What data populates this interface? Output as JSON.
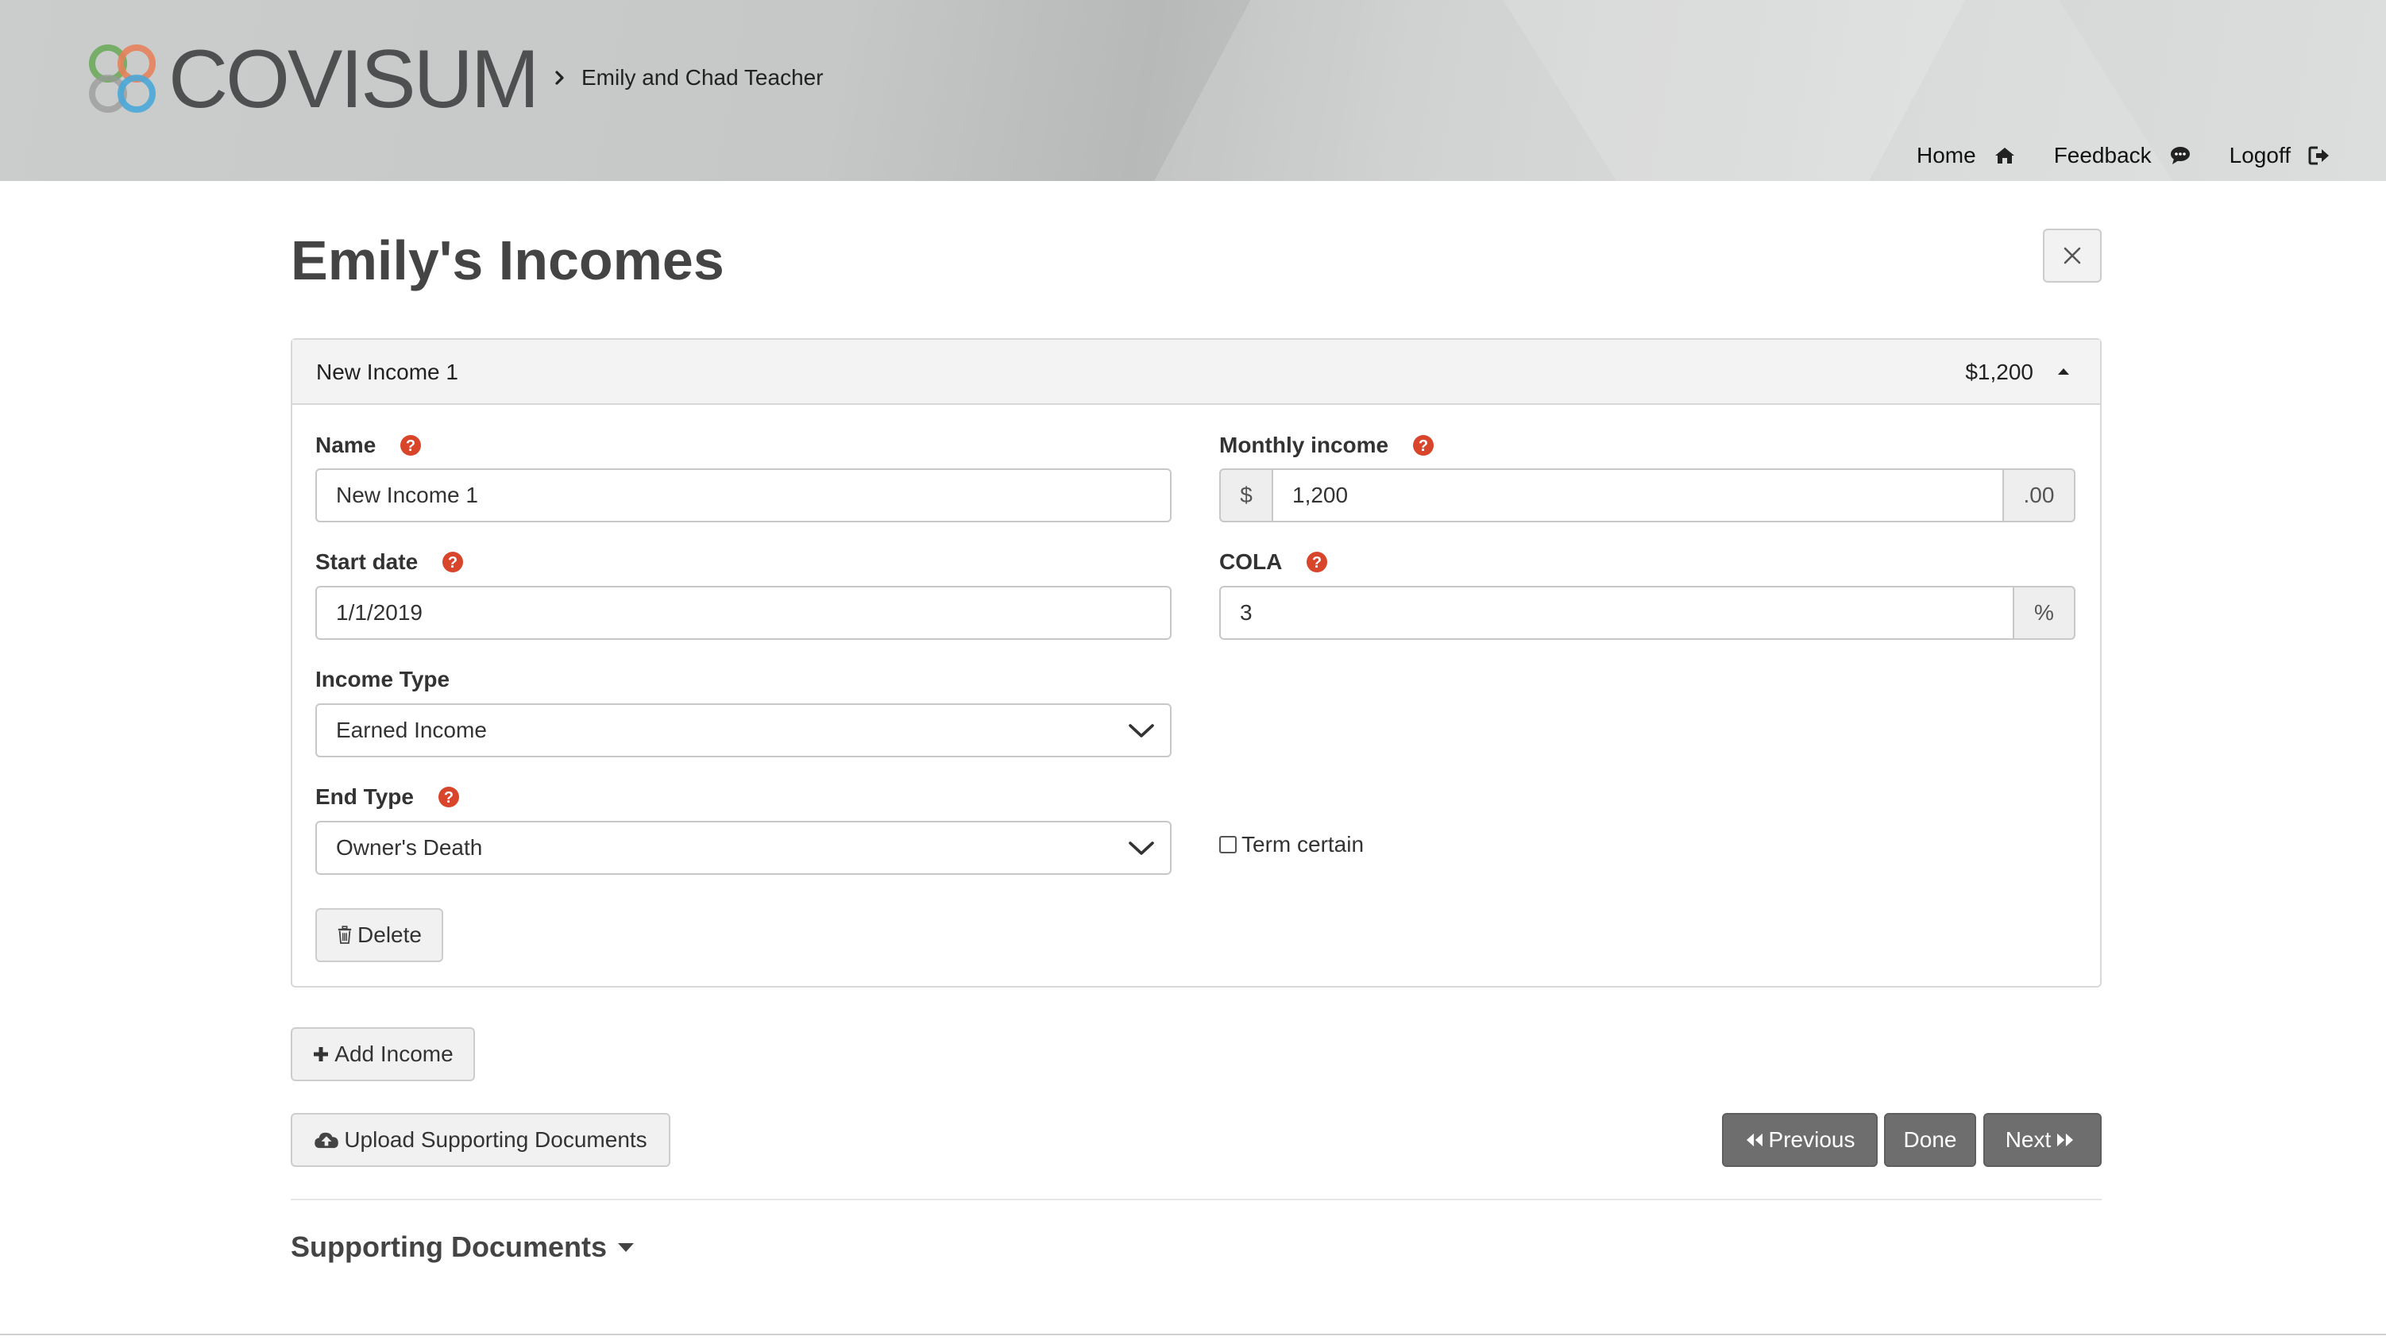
{
  "header": {
    "brand": "COVISUM",
    "breadcrumb": "Emily and Chad Teacher",
    "nav": [
      {
        "label": "Home",
        "icon": "home-icon"
      },
      {
        "label": "Feedback",
        "icon": "comment-icon"
      },
      {
        "label": "Logoff",
        "icon": "sign-out-icon"
      }
    ]
  },
  "page": {
    "title": "Emily's Incomes",
    "close_icon": "close-icon"
  },
  "income": {
    "panel_name": "New Income 1",
    "panel_amount": "$1,200",
    "name_label": "Name",
    "name_value": "New Income 1",
    "monthly_label": "Monthly income",
    "monthly_prefix": "$",
    "monthly_value": "1,200",
    "monthly_suffix": ".00",
    "start_label": "Start date",
    "start_value": "1/1/2019",
    "cola_label": "COLA",
    "cola_value": "3",
    "cola_suffix": "%",
    "type_label": "Income Type",
    "type_value": "Earned Income",
    "end_label": "End Type",
    "end_value": "Owner's Death",
    "term_label": "Term certain",
    "term_checked": false,
    "delete_label": "Delete"
  },
  "actions": {
    "add_income": "Add Income",
    "upload": "Upload Supporting Documents",
    "previous": "Previous",
    "done": "Done",
    "next": "Next"
  },
  "supporting": {
    "title": "Supporting Documents"
  },
  "colors": {
    "help_red": "#d9452b",
    "dark_button": "#6e6e6e",
    "logo_green": "#6dab5c",
    "logo_orange": "#e5825c",
    "logo_blue": "#4aa8d8",
    "logo_gray": "#9a9a9a"
  }
}
